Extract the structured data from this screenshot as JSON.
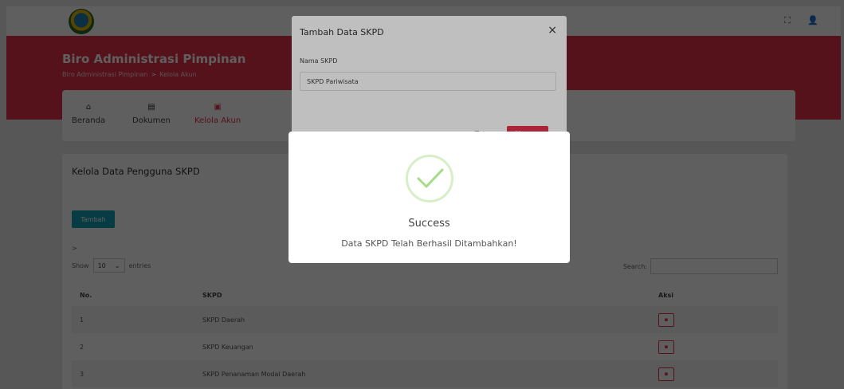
{
  "header": {
    "title": "Biro Administrasi Pimpinan",
    "breadcrumb": [
      "Biro Administrasi Pimpinan",
      "Kelola Akun"
    ],
    "breadcrumb_sep": ">"
  },
  "nav": [
    {
      "label": "Beranda",
      "icon": "home-icon"
    },
    {
      "label": "Dokumen",
      "icon": "document-icon"
    },
    {
      "label": "Kelola Akun",
      "icon": "account-icon"
    }
  ],
  "content": {
    "title": "Kelola Data Pengguna SKPD",
    "add_button": "Tambah",
    "arrow": ">",
    "show_label": "Show",
    "show_value": "10",
    "entries_label": "entries",
    "search_label": "Search:",
    "columns": {
      "no": "No.",
      "skpd": "SKPD",
      "aksi": "Aksi"
    },
    "rows": [
      {
        "no": "1",
        "skpd": "SKPD Daerah"
      },
      {
        "no": "2",
        "skpd": "SKPD Keuangan"
      },
      {
        "no": "3",
        "skpd": "SKPD Penanaman Modal Daerah"
      }
    ]
  },
  "form_modal": {
    "title": "Tambah Data SKPD",
    "close": "×",
    "field_label": "Nama SKPD",
    "field_value": "SKPD Pariwisata",
    "cancel": "Tutup",
    "submit": "Simpan"
  },
  "success_modal": {
    "title": "Success",
    "message": "Data SKPD Telah Berhasil Ditambahkan!"
  },
  "colors": {
    "accent": "#e4304b",
    "button_info": "#17a2b8",
    "success": "#a5dc86"
  }
}
